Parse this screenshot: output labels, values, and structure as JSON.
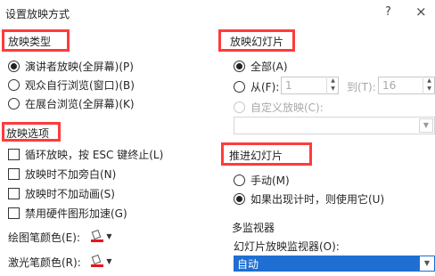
{
  "dialog": {
    "title": "设置放映方式",
    "help_glyph": "?",
    "close_glyph": "×"
  },
  "show_type": {
    "heading": "放映类型",
    "options": [
      {
        "label": "演讲者放映(全屏幕)(P)",
        "checked": true
      },
      {
        "label": "观众自行浏览(窗口)(B)",
        "checked": false
      },
      {
        "label": "在展台浏览(全屏幕)(K)",
        "checked": false
      }
    ]
  },
  "show_options": {
    "heading": "放映选项",
    "checkboxes": [
      {
        "label": "循环放映，按 ESC 键终止(L)",
        "checked": false
      },
      {
        "label": "放映时不加旁白(N)",
        "checked": false
      },
      {
        "label": "放映时不加动画(S)",
        "checked": false
      },
      {
        "label": "禁用硬件图形加速(G)",
        "checked": false
      }
    ],
    "pen_color_label": "绘图笔颜色(E):",
    "laser_color_label": "激光笔颜色(R):",
    "pen_color": "#e8141b",
    "laser_color": "#e8141b"
  },
  "slides": {
    "heading": "放映幻灯片",
    "all_label": "全部(A)",
    "from_label": "从(F):",
    "from_value": "1",
    "to_label": "到(T):",
    "to_value": "16",
    "custom_label": "自定义放映(C):"
  },
  "advance": {
    "heading": "推进幻灯片",
    "options": [
      {
        "label": "手动(M)",
        "checked": false
      },
      {
        "label": "如果出现计时，则使用它(U)",
        "checked": true
      }
    ]
  },
  "monitors": {
    "heading": "多监视器",
    "monitor_label": "幻灯片放映监视器(O):",
    "monitor_value": "自动"
  },
  "colors": {
    "highlight_box": "#ff3b3b",
    "selection": "#1e6fd1"
  }
}
